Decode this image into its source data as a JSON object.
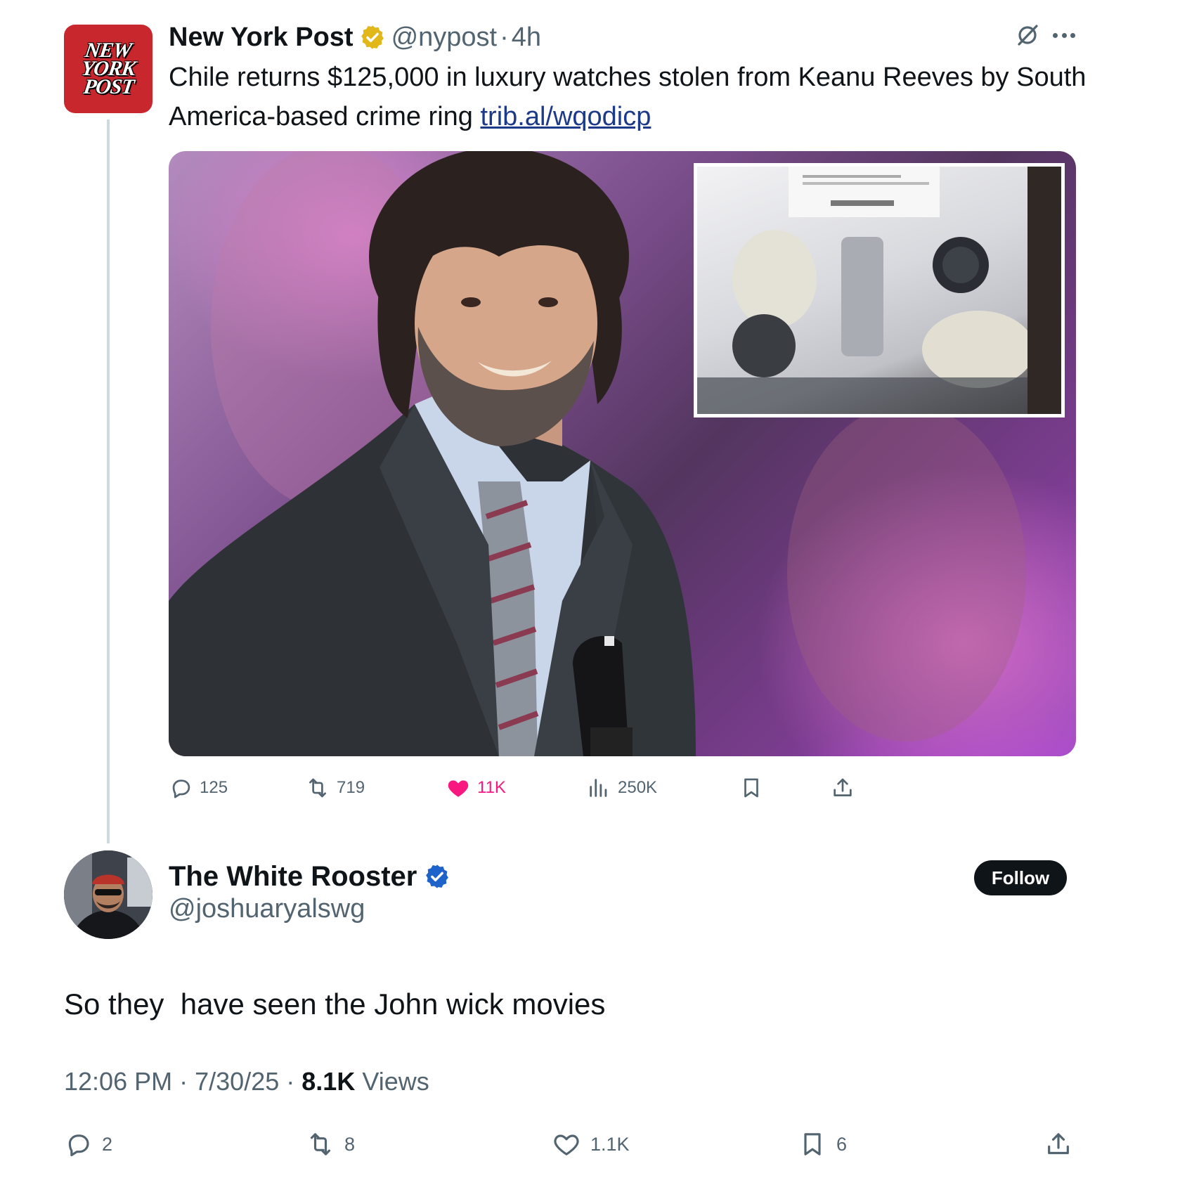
{
  "parent_tweet": {
    "avatar_logo_lines": [
      "NEW",
      "YORK",
      "POST"
    ],
    "display_name": "New York Post",
    "verified_badge": "gold-check-icon",
    "handle": "@nypost",
    "separator": "·",
    "time_ago": "4h",
    "text": "Chile returns $125,000 in luxury watches stolen from Keanu Reeves by South America-based crime ring ",
    "link": "trib.al/wqodicp",
    "media": {
      "main_photo": "man-in-suit-smiling-photo",
      "inset_photo": "evidence-bag-watches-photo"
    },
    "actions": {
      "replies": "125",
      "reposts": "719",
      "likes": "11K",
      "views": "250K"
    },
    "colors": {
      "like": "#f91880",
      "muted": "#536471",
      "link": "#1d3a8a"
    }
  },
  "main_tweet": {
    "display_name": "The White Rooster",
    "verified_badge": "blue-check-icon",
    "handle": "@joshuaryalswg",
    "follow_label": "Follow",
    "text": "So they  have seen the John wick movies",
    "time": "12:06 PM",
    "date": "7/30/25",
    "separator": "·",
    "views_count": "8.1K",
    "views_label": "Views",
    "actions": {
      "replies": "2",
      "reposts": "8",
      "likes": "1.1K",
      "bookmarks": "6"
    }
  }
}
